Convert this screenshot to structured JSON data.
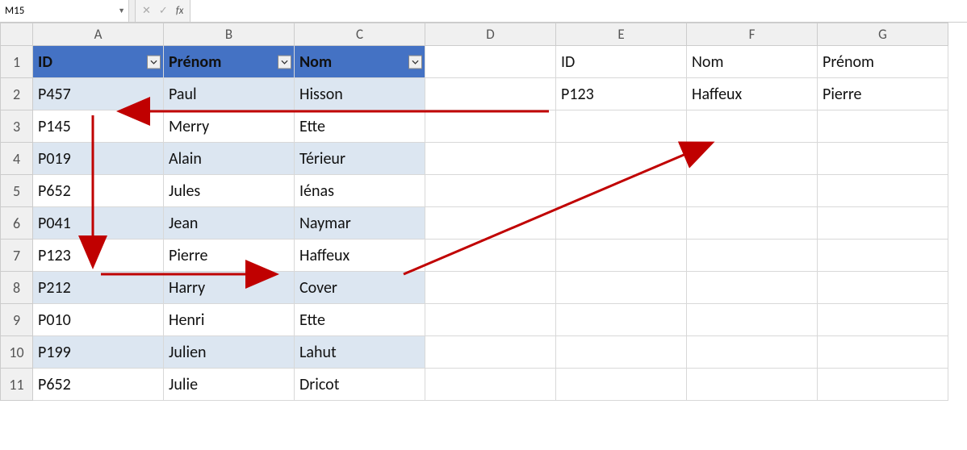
{
  "namebox": "M15",
  "formula": "",
  "fb_icons": {
    "cancel": "✕",
    "confirm": "✓",
    "fx": "fx"
  },
  "columns": [
    "A",
    "B",
    "C",
    "D",
    "E",
    "F",
    "G"
  ],
  "rows": [
    "1",
    "2",
    "3",
    "4",
    "5",
    "6",
    "7",
    "8",
    "9",
    "10",
    "11"
  ],
  "table": {
    "headers": {
      "A": "ID",
      "B": "Prénom",
      "C": "Nom"
    },
    "data": [
      {
        "A": "P457",
        "B": "Paul",
        "C": "Hisson"
      },
      {
        "A": "P145",
        "B": "Merry",
        "C": "Ette"
      },
      {
        "A": "P019",
        "B": "Alain",
        "C": "Térieur"
      },
      {
        "A": "P652",
        "B": "Jules",
        "C": "Iénas"
      },
      {
        "A": "P041",
        "B": "Jean",
        "C": "Naymar"
      },
      {
        "A": "P123",
        "B": "Pierre",
        "C": "Haffeux"
      },
      {
        "A": "P212",
        "B": "Harry",
        "C": "Cover"
      },
      {
        "A": "P010",
        "B": "Henri",
        "C": "Ette"
      },
      {
        "A": "P199",
        "B": "Julien",
        "C": "Lahut"
      },
      {
        "A": "P652",
        "B": "Julie",
        "C": "Dricot"
      }
    ]
  },
  "lookup": {
    "headers": {
      "E": "ID",
      "F": "Nom",
      "G": "Prénom"
    },
    "row": {
      "E": "P123",
      "F": "Haffeux",
      "G": "Pierre"
    }
  },
  "colors": {
    "table_header_bg": "#4472C4",
    "table_band_bg": "#DCE6F1",
    "arrow": "#C00000"
  }
}
